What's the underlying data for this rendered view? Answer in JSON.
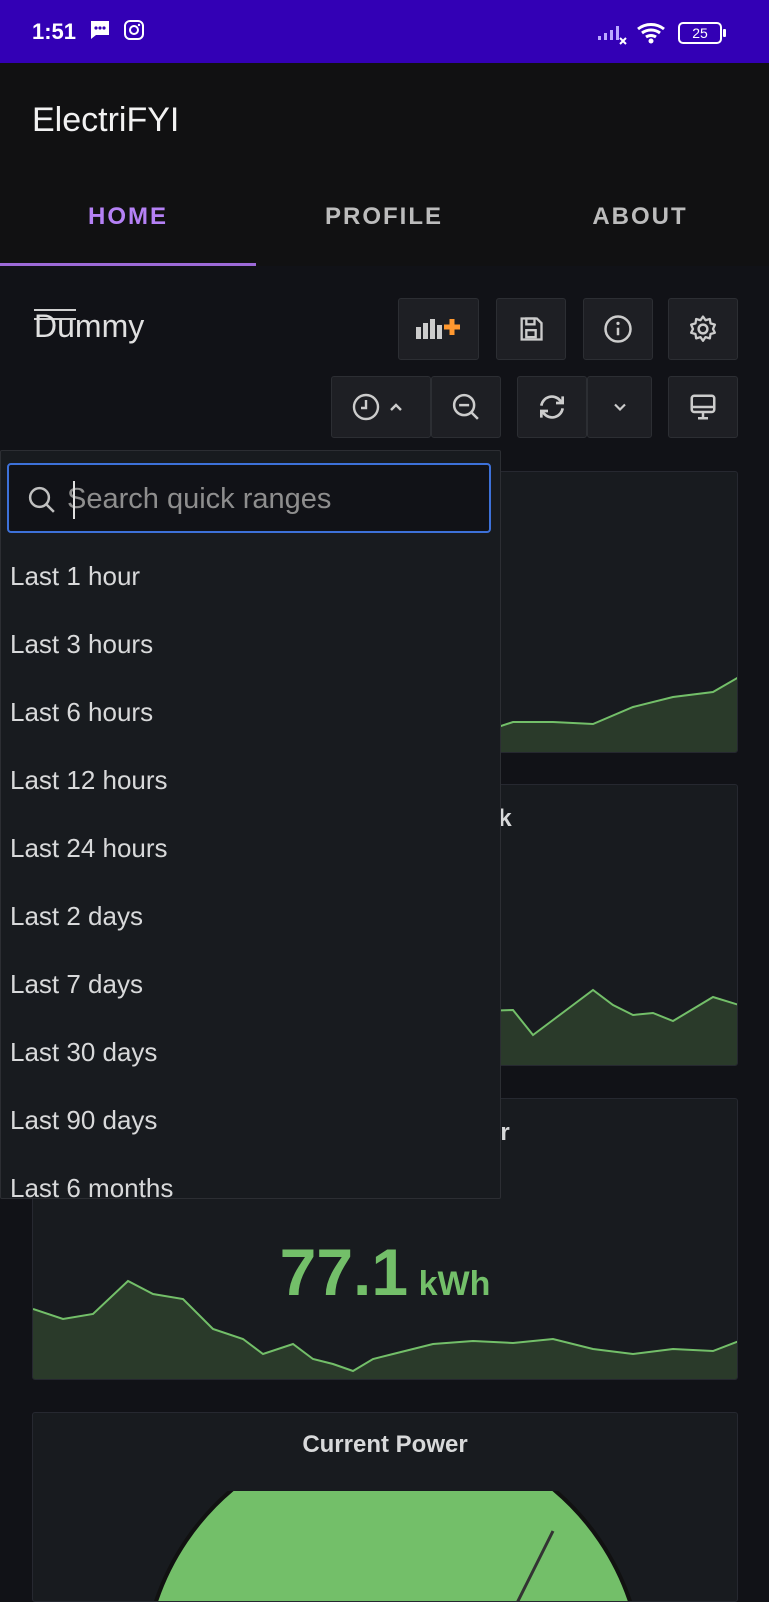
{
  "status_bar": {
    "time": "1:51",
    "battery": "25"
  },
  "app": {
    "title": "ElectriFYI"
  },
  "tabs": [
    {
      "label": "HOME",
      "active": true
    },
    {
      "label": "PROFILE",
      "active": false
    },
    {
      "label": "ABOUT",
      "active": false
    }
  ],
  "dashboard": {
    "title": "Dummy"
  },
  "time_picker": {
    "search_placeholder": "Search quick ranges",
    "options": [
      "Last 1 hour",
      "Last 3 hours",
      "Last 6 hours",
      "Last 12 hours",
      "Last 24 hours",
      "Last 2 days",
      "Last 7 days",
      "Last 30 days",
      "Last 90 days",
      "Last 6 months"
    ]
  },
  "panels": [
    {
      "title_fragment": ""
    },
    {
      "title_fragment": "k"
    },
    {
      "title_fragment": "r",
      "value": "77.1",
      "unit": "kWh"
    },
    {
      "title": "Current Power"
    }
  ],
  "colors": {
    "accent": "#b581f5",
    "series": "#73bf69",
    "focus": "#3d71d9",
    "statusbar": "#3300b5",
    "add_panel": "#ff9830"
  }
}
